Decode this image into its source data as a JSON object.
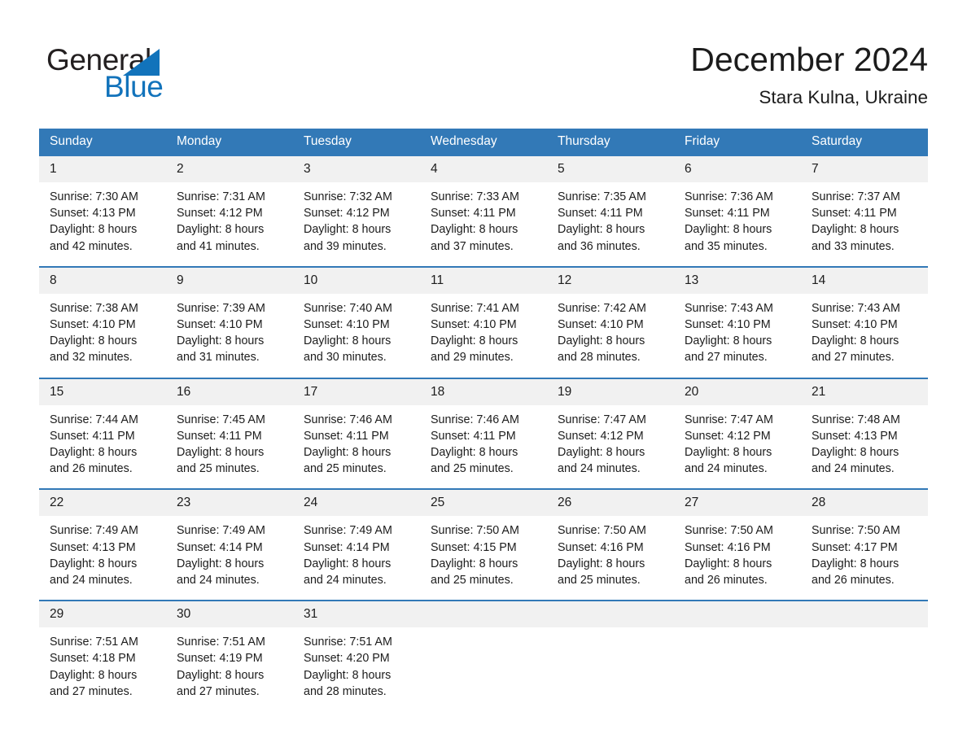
{
  "brand": {
    "name_part1": "General",
    "name_part2": "Blue",
    "triangle_icon": "blue-triangle-icon",
    "accent_color": "#1273bb"
  },
  "header": {
    "title": "December 2024",
    "subtitle": "Stara Kulna, Ukraine"
  },
  "theme": {
    "header_blue": "#3279b7",
    "daynum_bg": "#f1f1f1",
    "text": "#1c1c1c"
  },
  "calendar": {
    "weekday_headers": [
      "Sunday",
      "Monday",
      "Tuesday",
      "Wednesday",
      "Thursday",
      "Friday",
      "Saturday"
    ],
    "weeks": [
      [
        {
          "day": "1",
          "sunrise": "Sunrise: 7:30 AM",
          "sunset": "Sunset: 4:13 PM",
          "daylight_line1": "Daylight: 8 hours",
          "daylight_line2": "and 42 minutes."
        },
        {
          "day": "2",
          "sunrise": "Sunrise: 7:31 AM",
          "sunset": "Sunset: 4:12 PM",
          "daylight_line1": "Daylight: 8 hours",
          "daylight_line2": "and 41 minutes."
        },
        {
          "day": "3",
          "sunrise": "Sunrise: 7:32 AM",
          "sunset": "Sunset: 4:12 PM",
          "daylight_line1": "Daylight: 8 hours",
          "daylight_line2": "and 39 minutes."
        },
        {
          "day": "4",
          "sunrise": "Sunrise: 7:33 AM",
          "sunset": "Sunset: 4:11 PM",
          "daylight_line1": "Daylight: 8 hours",
          "daylight_line2": "and 37 minutes."
        },
        {
          "day": "5",
          "sunrise": "Sunrise: 7:35 AM",
          "sunset": "Sunset: 4:11 PM",
          "daylight_line1": "Daylight: 8 hours",
          "daylight_line2": "and 36 minutes."
        },
        {
          "day": "6",
          "sunrise": "Sunrise: 7:36 AM",
          "sunset": "Sunset: 4:11 PM",
          "daylight_line1": "Daylight: 8 hours",
          "daylight_line2": "and 35 minutes."
        },
        {
          "day": "7",
          "sunrise": "Sunrise: 7:37 AM",
          "sunset": "Sunset: 4:11 PM",
          "daylight_line1": "Daylight: 8 hours",
          "daylight_line2": "and 33 minutes."
        }
      ],
      [
        {
          "day": "8",
          "sunrise": "Sunrise: 7:38 AM",
          "sunset": "Sunset: 4:10 PM",
          "daylight_line1": "Daylight: 8 hours",
          "daylight_line2": "and 32 minutes."
        },
        {
          "day": "9",
          "sunrise": "Sunrise: 7:39 AM",
          "sunset": "Sunset: 4:10 PM",
          "daylight_line1": "Daylight: 8 hours",
          "daylight_line2": "and 31 minutes."
        },
        {
          "day": "10",
          "sunrise": "Sunrise: 7:40 AM",
          "sunset": "Sunset: 4:10 PM",
          "daylight_line1": "Daylight: 8 hours",
          "daylight_line2": "and 30 minutes."
        },
        {
          "day": "11",
          "sunrise": "Sunrise: 7:41 AM",
          "sunset": "Sunset: 4:10 PM",
          "daylight_line1": "Daylight: 8 hours",
          "daylight_line2": "and 29 minutes."
        },
        {
          "day": "12",
          "sunrise": "Sunrise: 7:42 AM",
          "sunset": "Sunset: 4:10 PM",
          "daylight_line1": "Daylight: 8 hours",
          "daylight_line2": "and 28 minutes."
        },
        {
          "day": "13",
          "sunrise": "Sunrise: 7:43 AM",
          "sunset": "Sunset: 4:10 PM",
          "daylight_line1": "Daylight: 8 hours",
          "daylight_line2": "and 27 minutes."
        },
        {
          "day": "14",
          "sunrise": "Sunrise: 7:43 AM",
          "sunset": "Sunset: 4:10 PM",
          "daylight_line1": "Daylight: 8 hours",
          "daylight_line2": "and 27 minutes."
        }
      ],
      [
        {
          "day": "15",
          "sunrise": "Sunrise: 7:44 AM",
          "sunset": "Sunset: 4:11 PM",
          "daylight_line1": "Daylight: 8 hours",
          "daylight_line2": "and 26 minutes."
        },
        {
          "day": "16",
          "sunrise": "Sunrise: 7:45 AM",
          "sunset": "Sunset: 4:11 PM",
          "daylight_line1": "Daylight: 8 hours",
          "daylight_line2": "and 25 minutes."
        },
        {
          "day": "17",
          "sunrise": "Sunrise: 7:46 AM",
          "sunset": "Sunset: 4:11 PM",
          "daylight_line1": "Daylight: 8 hours",
          "daylight_line2": "and 25 minutes."
        },
        {
          "day": "18",
          "sunrise": "Sunrise: 7:46 AM",
          "sunset": "Sunset: 4:11 PM",
          "daylight_line1": "Daylight: 8 hours",
          "daylight_line2": "and 25 minutes."
        },
        {
          "day": "19",
          "sunrise": "Sunrise: 7:47 AM",
          "sunset": "Sunset: 4:12 PM",
          "daylight_line1": "Daylight: 8 hours",
          "daylight_line2": "and 24 minutes."
        },
        {
          "day": "20",
          "sunrise": "Sunrise: 7:47 AM",
          "sunset": "Sunset: 4:12 PM",
          "daylight_line1": "Daylight: 8 hours",
          "daylight_line2": "and 24 minutes."
        },
        {
          "day": "21",
          "sunrise": "Sunrise: 7:48 AM",
          "sunset": "Sunset: 4:13 PM",
          "daylight_line1": "Daylight: 8 hours",
          "daylight_line2": "and 24 minutes."
        }
      ],
      [
        {
          "day": "22",
          "sunrise": "Sunrise: 7:49 AM",
          "sunset": "Sunset: 4:13 PM",
          "daylight_line1": "Daylight: 8 hours",
          "daylight_line2": "and 24 minutes."
        },
        {
          "day": "23",
          "sunrise": "Sunrise: 7:49 AM",
          "sunset": "Sunset: 4:14 PM",
          "daylight_line1": "Daylight: 8 hours",
          "daylight_line2": "and 24 minutes."
        },
        {
          "day": "24",
          "sunrise": "Sunrise: 7:49 AM",
          "sunset": "Sunset: 4:14 PM",
          "daylight_line1": "Daylight: 8 hours",
          "daylight_line2": "and 24 minutes."
        },
        {
          "day": "25",
          "sunrise": "Sunrise: 7:50 AM",
          "sunset": "Sunset: 4:15 PM",
          "daylight_line1": "Daylight: 8 hours",
          "daylight_line2": "and 25 minutes."
        },
        {
          "day": "26",
          "sunrise": "Sunrise: 7:50 AM",
          "sunset": "Sunset: 4:16 PM",
          "daylight_line1": "Daylight: 8 hours",
          "daylight_line2": "and 25 minutes."
        },
        {
          "day": "27",
          "sunrise": "Sunrise: 7:50 AM",
          "sunset": "Sunset: 4:16 PM",
          "daylight_line1": "Daylight: 8 hours",
          "daylight_line2": "and 26 minutes."
        },
        {
          "day": "28",
          "sunrise": "Sunrise: 7:50 AM",
          "sunset": "Sunset: 4:17 PM",
          "daylight_line1": "Daylight: 8 hours",
          "daylight_line2": "and 26 minutes."
        }
      ],
      [
        {
          "day": "29",
          "sunrise": "Sunrise: 7:51 AM",
          "sunset": "Sunset: 4:18 PM",
          "daylight_line1": "Daylight: 8 hours",
          "daylight_line2": "and 27 minutes."
        },
        {
          "day": "30",
          "sunrise": "Sunrise: 7:51 AM",
          "sunset": "Sunset: 4:19 PM",
          "daylight_line1": "Daylight: 8 hours",
          "daylight_line2": "and 27 minutes."
        },
        {
          "day": "31",
          "sunrise": "Sunrise: 7:51 AM",
          "sunset": "Sunset: 4:20 PM",
          "daylight_line1": "Daylight: 8 hours",
          "daylight_line2": "and 28 minutes."
        },
        {
          "day": "",
          "sunrise": "",
          "sunset": "",
          "daylight_line1": "",
          "daylight_line2": ""
        },
        {
          "day": "",
          "sunrise": "",
          "sunset": "",
          "daylight_line1": "",
          "daylight_line2": ""
        },
        {
          "day": "",
          "sunrise": "",
          "sunset": "",
          "daylight_line1": "",
          "daylight_line2": ""
        },
        {
          "day": "",
          "sunrise": "",
          "sunset": "",
          "daylight_line1": "",
          "daylight_line2": ""
        }
      ]
    ]
  }
}
